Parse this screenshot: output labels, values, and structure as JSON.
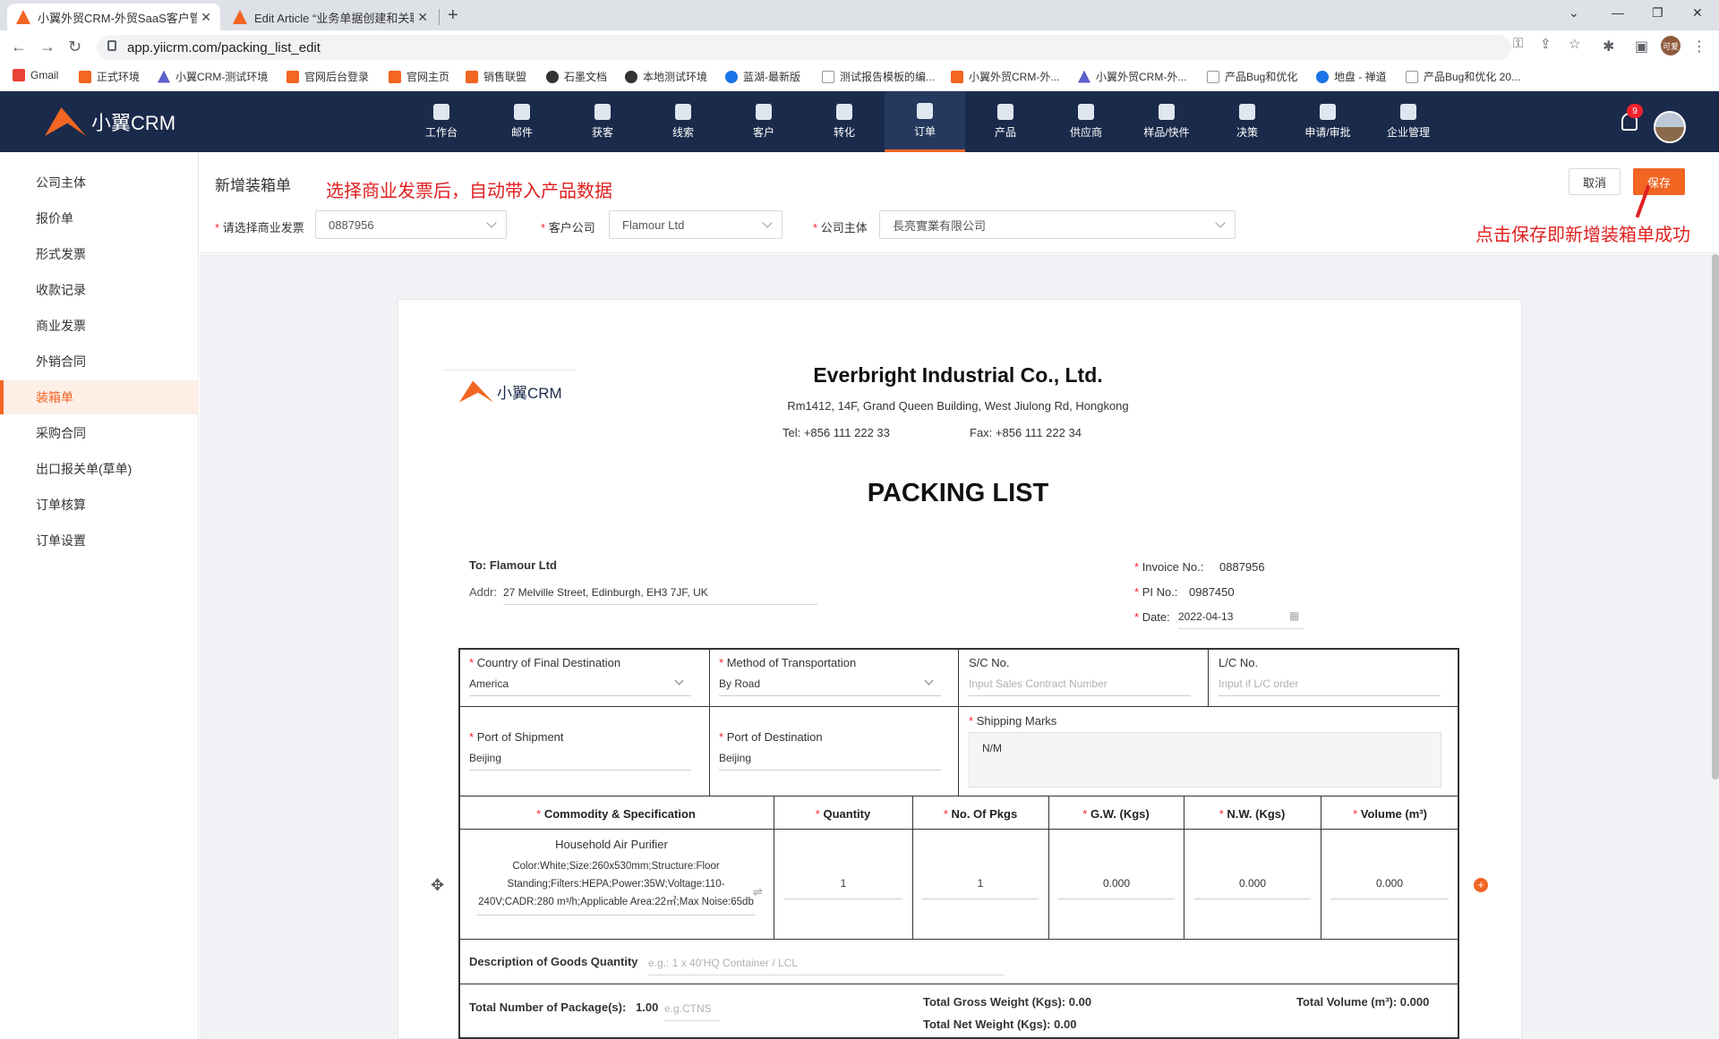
{
  "browser": {
    "tabs": [
      {
        "title": "小翼外贸CRM-外贸SaaS客户管理",
        "active": true
      },
      {
        "title": "Edit Article “业务单据创建和关联",
        "active": false
      }
    ],
    "url": "app.yiicrm.com/packing_list_edit",
    "bookmarks": [
      "Gmail",
      "正式环境",
      "小翼CRM-测试环境",
      "官网后台登录",
      "官网主页",
      "销售联盟",
      "石墨文档",
      "本地测试环境",
      "蓝湖-最新版",
      "测试报告模板的编...",
      "小翼外贸CRM-外...",
      "小翼外贸CRM-外...",
      "产品Bug和优化",
      "地盘 - 禅道",
      "产品Bug和优化 20..."
    ],
    "profile": "可爱"
  },
  "app": {
    "brand": "小翼CRM",
    "nav": [
      "工作台",
      "邮件",
      "获客",
      "线索",
      "客户",
      "转化",
      "订单",
      "产品",
      "供应商",
      "样品/快件",
      "决策",
      "申请/审批",
      "企业管理"
    ],
    "active_nav": "订单",
    "notifications": "9"
  },
  "sidebar": [
    "公司主体",
    "报价单",
    "形式发票",
    "收款记录",
    "商业发票",
    "外销合同",
    "装箱单",
    "采购合同",
    "出口报关单(草单)",
    "订单核算",
    "订单设置"
  ],
  "sidebar_active": "装箱单",
  "form": {
    "title": "新增装箱单",
    "annotation_top": "选择商业发票后，自动带入产品数据",
    "annotation_save": "点击保存即新增装箱单成功",
    "cancel": "取消",
    "save": "保存",
    "invoice_label": "请选择商业发票",
    "invoice_value": "0887956",
    "customer_label": "客户公司",
    "customer_value": "Flamour Ltd",
    "entity_label": "公司主体",
    "entity_value": "長亮實業有限公司",
    "req": "*"
  },
  "doc": {
    "logo_text": "小翼CRM",
    "company": "Everbright Industrial Co., Ltd.",
    "address": "Rm1412, 14F, Grand Queen Building, West Jiulong Rd, Hongkong",
    "tel": "Tel: +856 111 222 33",
    "fax": "Fax: +856 111 222 34",
    "title": "PACKING LIST",
    "to": "To: Flamour Ltd",
    "addr_label": "Addr:",
    "addr_value": "27 Melville Street, Edinburgh, EH3 7JF, UK",
    "invoice_no_label": "Invoice No.:",
    "invoice_no": "0887956",
    "pi_no_label": "PI No.:",
    "pi_no": "0987450",
    "date_label": "Date:",
    "date": "2022-04-13"
  },
  "grid": {
    "country_label": "Country of Final Destination",
    "country_value": "America",
    "method_label": "Method of Transportation",
    "method_value": "By Road",
    "sc_label": "S/C No.",
    "sc_placeholder": "Input Sales  Contract Number",
    "lc_label": "L/C No.",
    "lc_placeholder": "Input if L/C order",
    "pos_label": "Port of Shipment",
    "pos_value": "Beijing",
    "pod_label": "Port of Destination",
    "pod_value": "Beijing",
    "marks_label": "Shipping Marks",
    "marks_value": "N/M",
    "headers": [
      "Commodity & Specification",
      "Quantity",
      "No. Of Pkgs",
      "G.W. (Kgs)",
      "N.W. (Kgs)",
      "Volume (m³)"
    ],
    "product_name": "Household Air Purifier",
    "product_spec": "Color:White;Size:260x530mm;Structure:Floor Standing;Filters:HEPA;Power:35W;Voltage:110-240V;CADR:280 m³/h;Applicable Area:22㎡;Max Noise:65db",
    "row_values": [
      "1",
      "1",
      "0.000",
      "0.000",
      "0.000"
    ],
    "desc_label": "Description of Goods Quantity",
    "desc_placeholder": "e.g.: 1 x 40'HQ Container / LCL",
    "total_pkgs_label": "Total Number of Package(s):",
    "total_pkgs": "1.00",
    "total_pkgs_placeholder": "e.g.CTNS",
    "total_gw": "Total Gross Weight (Kgs): 0.00",
    "total_nw": "Total Net Weight (Kgs): 0.00",
    "total_vol": "Total Volume (m³): 0.000"
  }
}
